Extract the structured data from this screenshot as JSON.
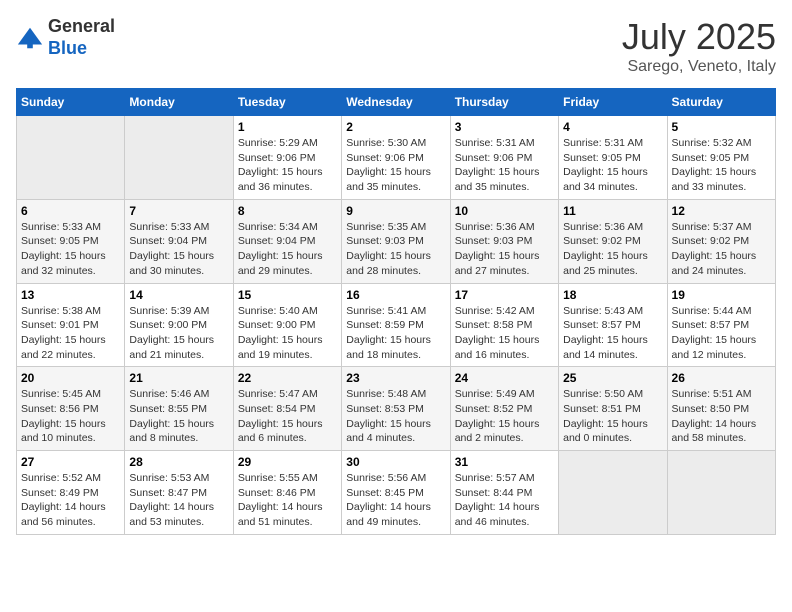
{
  "header": {
    "logo_line1": "General",
    "logo_line2": "Blue",
    "month": "July 2025",
    "location": "Sarego, Veneto, Italy"
  },
  "weekdays": [
    "Sunday",
    "Monday",
    "Tuesday",
    "Wednesday",
    "Thursday",
    "Friday",
    "Saturday"
  ],
  "weeks": [
    [
      {
        "day": "",
        "info": ""
      },
      {
        "day": "",
        "info": ""
      },
      {
        "day": "1",
        "info": "Sunrise: 5:29 AM\nSunset: 9:06 PM\nDaylight: 15 hours and 36 minutes."
      },
      {
        "day": "2",
        "info": "Sunrise: 5:30 AM\nSunset: 9:06 PM\nDaylight: 15 hours and 35 minutes."
      },
      {
        "day": "3",
        "info": "Sunrise: 5:31 AM\nSunset: 9:06 PM\nDaylight: 15 hours and 35 minutes."
      },
      {
        "day": "4",
        "info": "Sunrise: 5:31 AM\nSunset: 9:05 PM\nDaylight: 15 hours and 34 minutes."
      },
      {
        "day": "5",
        "info": "Sunrise: 5:32 AM\nSunset: 9:05 PM\nDaylight: 15 hours and 33 minutes."
      }
    ],
    [
      {
        "day": "6",
        "info": "Sunrise: 5:33 AM\nSunset: 9:05 PM\nDaylight: 15 hours and 32 minutes."
      },
      {
        "day": "7",
        "info": "Sunrise: 5:33 AM\nSunset: 9:04 PM\nDaylight: 15 hours and 30 minutes."
      },
      {
        "day": "8",
        "info": "Sunrise: 5:34 AM\nSunset: 9:04 PM\nDaylight: 15 hours and 29 minutes."
      },
      {
        "day": "9",
        "info": "Sunrise: 5:35 AM\nSunset: 9:03 PM\nDaylight: 15 hours and 28 minutes."
      },
      {
        "day": "10",
        "info": "Sunrise: 5:36 AM\nSunset: 9:03 PM\nDaylight: 15 hours and 27 minutes."
      },
      {
        "day": "11",
        "info": "Sunrise: 5:36 AM\nSunset: 9:02 PM\nDaylight: 15 hours and 25 minutes."
      },
      {
        "day": "12",
        "info": "Sunrise: 5:37 AM\nSunset: 9:02 PM\nDaylight: 15 hours and 24 minutes."
      }
    ],
    [
      {
        "day": "13",
        "info": "Sunrise: 5:38 AM\nSunset: 9:01 PM\nDaylight: 15 hours and 22 minutes."
      },
      {
        "day": "14",
        "info": "Sunrise: 5:39 AM\nSunset: 9:00 PM\nDaylight: 15 hours and 21 minutes."
      },
      {
        "day": "15",
        "info": "Sunrise: 5:40 AM\nSunset: 9:00 PM\nDaylight: 15 hours and 19 minutes."
      },
      {
        "day": "16",
        "info": "Sunrise: 5:41 AM\nSunset: 8:59 PM\nDaylight: 15 hours and 18 minutes."
      },
      {
        "day": "17",
        "info": "Sunrise: 5:42 AM\nSunset: 8:58 PM\nDaylight: 15 hours and 16 minutes."
      },
      {
        "day": "18",
        "info": "Sunrise: 5:43 AM\nSunset: 8:57 PM\nDaylight: 15 hours and 14 minutes."
      },
      {
        "day": "19",
        "info": "Sunrise: 5:44 AM\nSunset: 8:57 PM\nDaylight: 15 hours and 12 minutes."
      }
    ],
    [
      {
        "day": "20",
        "info": "Sunrise: 5:45 AM\nSunset: 8:56 PM\nDaylight: 15 hours and 10 minutes."
      },
      {
        "day": "21",
        "info": "Sunrise: 5:46 AM\nSunset: 8:55 PM\nDaylight: 15 hours and 8 minutes."
      },
      {
        "day": "22",
        "info": "Sunrise: 5:47 AM\nSunset: 8:54 PM\nDaylight: 15 hours and 6 minutes."
      },
      {
        "day": "23",
        "info": "Sunrise: 5:48 AM\nSunset: 8:53 PM\nDaylight: 15 hours and 4 minutes."
      },
      {
        "day": "24",
        "info": "Sunrise: 5:49 AM\nSunset: 8:52 PM\nDaylight: 15 hours and 2 minutes."
      },
      {
        "day": "25",
        "info": "Sunrise: 5:50 AM\nSunset: 8:51 PM\nDaylight: 15 hours and 0 minutes."
      },
      {
        "day": "26",
        "info": "Sunrise: 5:51 AM\nSunset: 8:50 PM\nDaylight: 14 hours and 58 minutes."
      }
    ],
    [
      {
        "day": "27",
        "info": "Sunrise: 5:52 AM\nSunset: 8:49 PM\nDaylight: 14 hours and 56 minutes."
      },
      {
        "day": "28",
        "info": "Sunrise: 5:53 AM\nSunset: 8:47 PM\nDaylight: 14 hours and 53 minutes."
      },
      {
        "day": "29",
        "info": "Sunrise: 5:55 AM\nSunset: 8:46 PM\nDaylight: 14 hours and 51 minutes."
      },
      {
        "day": "30",
        "info": "Sunrise: 5:56 AM\nSunset: 8:45 PM\nDaylight: 14 hours and 49 minutes."
      },
      {
        "day": "31",
        "info": "Sunrise: 5:57 AM\nSunset: 8:44 PM\nDaylight: 14 hours and 46 minutes."
      },
      {
        "day": "",
        "info": ""
      },
      {
        "day": "",
        "info": ""
      }
    ]
  ]
}
